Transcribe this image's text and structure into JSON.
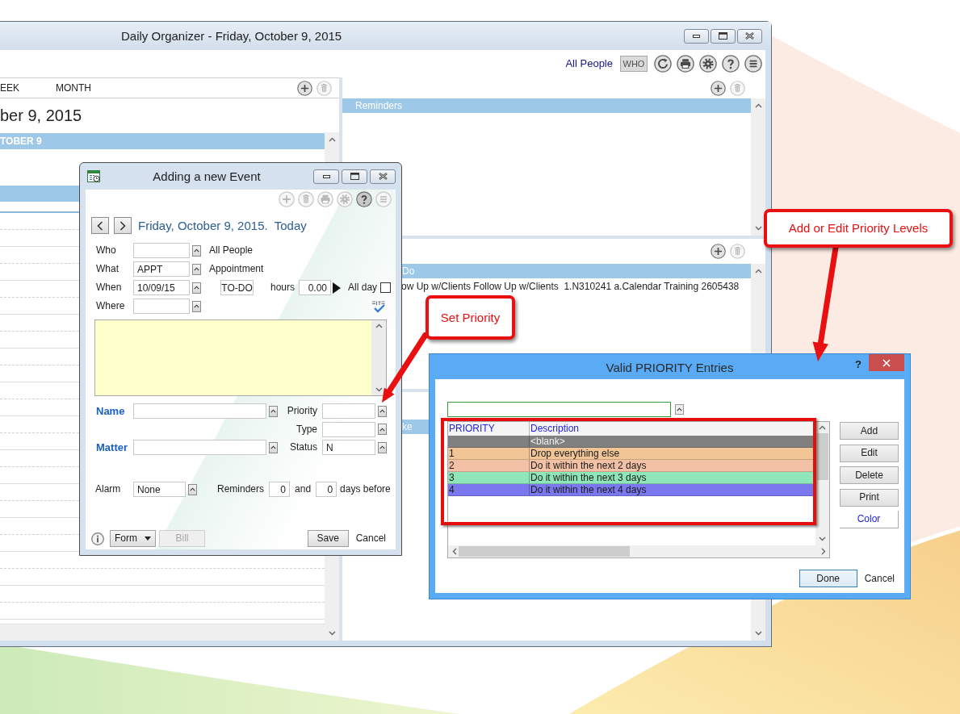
{
  "main_window": {
    "title": "Daily Organizer - Friday, October 9, 2015",
    "people_link": "All People",
    "who_button": "WHO",
    "view_tabs": [
      "EEK",
      "MONTH"
    ],
    "date_heading": "ber 9, 2015",
    "day_header": "TOBER 9",
    "reminders_header": "Reminders",
    "todo_header": "Do",
    "todo_items": [
      "ow Up w/Clients Follow Up w/Clients  1.N310241 a.Calendar Training 2605438"
    ],
    "third_header": "ke"
  },
  "event_dialog": {
    "title": "Adding a new Event",
    "date_line": "Friday, October 9, 2015.  Today",
    "who": {
      "label": "Who",
      "note": "All People"
    },
    "what": {
      "label": "What",
      "value": "APPT",
      "note": "Appointment"
    },
    "when": {
      "label": "When",
      "value": "10/09/15",
      "entry_type": "TO-DO",
      "hours_label": "hours",
      "hours": "0.00",
      "all_day_label": "All day",
      "all_day": false
    },
    "where": {
      "label": "Where"
    },
    "name": {
      "label": "Name"
    },
    "priority": {
      "label": "Priority"
    },
    "type": {
      "label": "Type"
    },
    "matter": {
      "label": "Matter"
    },
    "status": {
      "label": "Status",
      "value": "N"
    },
    "alarm": {
      "label": "Alarm",
      "value": "None"
    },
    "reminders": {
      "label": "Reminders",
      "first": "0",
      "joiner": "and",
      "second": "0",
      "suffix": "days before"
    },
    "footer": {
      "form_button": "Form",
      "bill_button": {
        "label": "Bill",
        "disabled": true
      },
      "save_button": "Save",
      "cancel_link": "Cancel"
    }
  },
  "priority_dialog": {
    "title": "Valid PRIORITY Entries",
    "help_button": "?",
    "columns": [
      "PRIORITY",
      "Description"
    ],
    "rows": [
      {
        "description": "<blank>",
        "color": "#808080"
      },
      {
        "priority": "1",
        "description": "Drop everything else",
        "color": "#f2c597"
      },
      {
        "priority": "2",
        "description": "Do it within the next 2 days",
        "color": "#f3c1a5"
      },
      {
        "priority": "3",
        "description": "Do it within the next 3 days",
        "color": "#8ee6b9"
      },
      {
        "priority": "4",
        "description": "Do it within the next 4 days",
        "color": "#7b78ef"
      }
    ],
    "side_buttons": [
      "Add",
      "Edit",
      "Delete",
      "Print"
    ],
    "color_button": "Color",
    "done_button": "Done",
    "cancel_link": "Cancel"
  },
  "callouts": [
    {
      "text": "Set Priority"
    },
    {
      "text": "Add or Edit Priority Levels"
    }
  ]
}
